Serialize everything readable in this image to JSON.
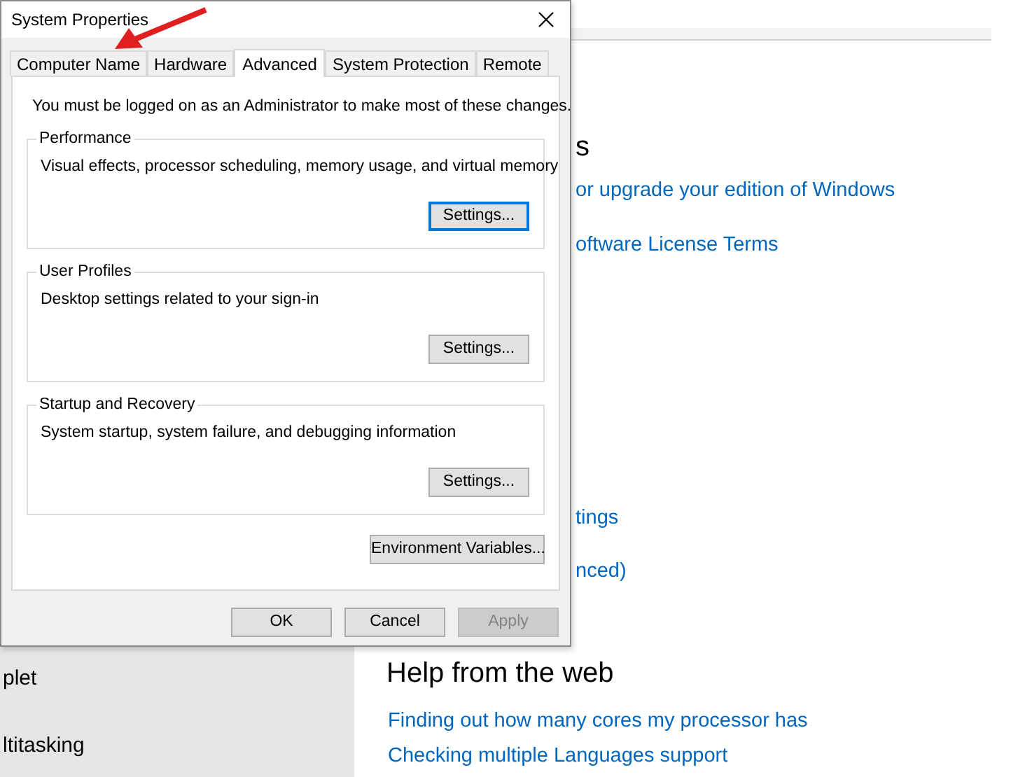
{
  "dialog": {
    "title": "System Properties",
    "tabs": [
      {
        "label": "Computer Name",
        "selected": false
      },
      {
        "label": "Hardware",
        "selected": false
      },
      {
        "label": "Advanced",
        "selected": true
      },
      {
        "label": "System Protection",
        "selected": false
      },
      {
        "label": "Remote",
        "selected": false
      }
    ],
    "notice": "You must be logged on as an Administrator to make most of these changes.",
    "groups": [
      {
        "label": "Performance",
        "description": "Visual effects, processor scheduling, memory usage, and virtual memory",
        "button": {
          "label": "Settings...",
          "focused": true
        }
      },
      {
        "label": "User Profiles",
        "description": "Desktop settings related to your sign-in",
        "button": {
          "label": "Settings...",
          "focused": false
        }
      },
      {
        "label": "Startup and Recovery",
        "description": "System startup, system failure, and debugging information",
        "button": {
          "label": "Settings...",
          "focused": false
        }
      }
    ],
    "environment_button": "Environment Variables...",
    "buttons": [
      {
        "label": "OK",
        "disabled": false
      },
      {
        "label": "Cancel",
        "disabled": false
      },
      {
        "label": "Apply",
        "disabled": true
      }
    ]
  },
  "background": {
    "sidebar_items": [
      "plet",
      "ltitasking"
    ],
    "heading": "s",
    "links_top": [
      "or upgrade your edition of Windows",
      "oftware License Terms"
    ],
    "links_middle": [
      "tings",
      "nced)"
    ],
    "help_heading": "Help from the web",
    "help_links": [
      "Finding out how many cores my processor has",
      "Checking multiple Languages support"
    ]
  }
}
